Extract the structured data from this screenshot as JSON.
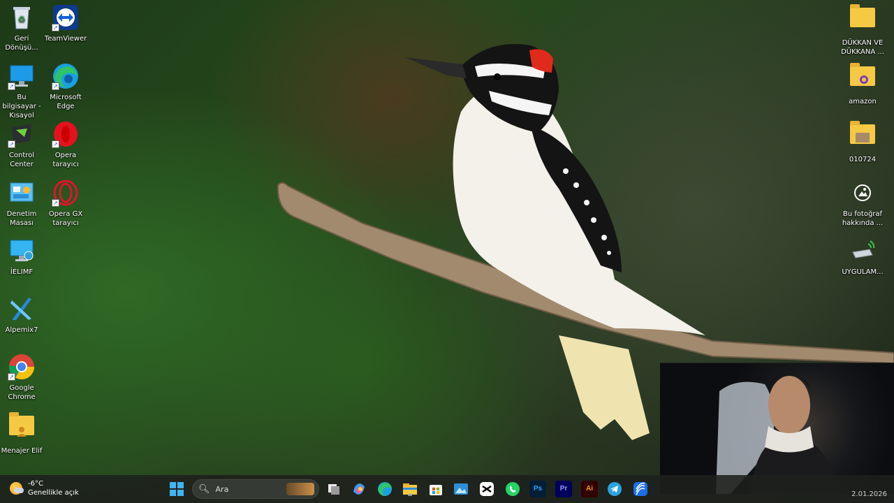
{
  "desktop": {
    "left_col1": [
      {
        "label": "Geri Dönüşü...",
        "icon": "recycle-bin-icon"
      },
      {
        "label": "Bu bilgisayar - Kısayol",
        "icon": "this-pc-icon"
      },
      {
        "label": "Control Center",
        "icon": "control-center-icon"
      },
      {
        "label": "Denetim Masası",
        "icon": "control-panel-icon"
      },
      {
        "label": "İELIMF",
        "icon": "network-pc-icon"
      },
      {
        "label": "Alpemix7",
        "icon": "alpemix-icon"
      },
      {
        "label": "Google Chrome",
        "icon": "chrome-icon"
      },
      {
        "label": "Menajer Elif",
        "icon": "user-folder-icon"
      }
    ],
    "left_col2": [
      {
        "label": "TeamViewer",
        "icon": "teamviewer-icon"
      },
      {
        "label": "Microsoft Edge",
        "icon": "edge-icon"
      },
      {
        "label": "Opera tarayıcı",
        "icon": "opera-icon"
      },
      {
        "label": "Opera GX tarayıcı",
        "icon": "opera-gx-icon"
      }
    ],
    "right_col": [
      {
        "label": "DÜKKAN VE DÜKKANA ...",
        "icon": "folder-icon"
      },
      {
        "label": "amazon",
        "icon": "folder-icon"
      },
      {
        "label": "010724",
        "icon": "folder-icon"
      },
      {
        "label": "Bu fotoğraf hakkında ...",
        "icon": "photo-info-icon"
      },
      {
        "label": "UYGULAM...",
        "icon": "usb-drive-icon"
      }
    ]
  },
  "taskbar": {
    "weather_temp": "-6°C",
    "weather_desc": "Genellikle açık",
    "search_placeholder": "Ara",
    "apps": [
      {
        "name": "task-view",
        "label": ""
      },
      {
        "name": "copilot",
        "label": ""
      },
      {
        "name": "edge",
        "label": ""
      },
      {
        "name": "file-explorer",
        "label": ""
      },
      {
        "name": "microsoft-store",
        "label": ""
      },
      {
        "name": "photos",
        "label": ""
      },
      {
        "name": "capcut",
        "label": ""
      },
      {
        "name": "whatsapp",
        "label": ""
      },
      {
        "name": "photoshop",
        "label": "Ps"
      },
      {
        "name": "premiere",
        "label": "Pr"
      },
      {
        "name": "illustrator",
        "label": "Ai"
      },
      {
        "name": "telegram",
        "label": ""
      },
      {
        "name": "app-blue",
        "label": ""
      }
    ],
    "clock_date": "2.01.2026"
  },
  "colors": {
    "ps": "#31a8ff",
    "pr": "#9999ff",
    "ai": "#ff9a00",
    "whatsapp": "#25d366",
    "telegram": "#2aa3e0"
  }
}
